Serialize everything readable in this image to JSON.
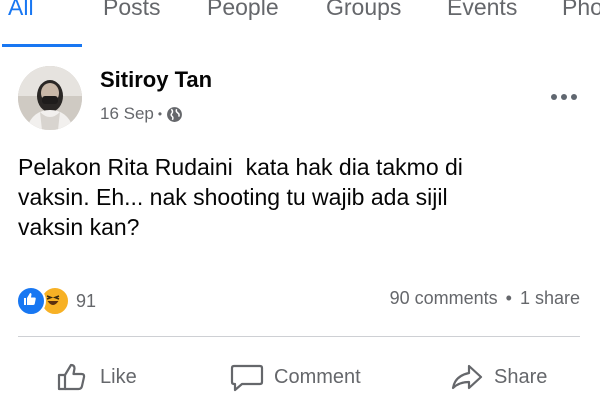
{
  "tabs": [
    {
      "label": "All",
      "active": true
    },
    {
      "label": "Posts",
      "active": false
    },
    {
      "label": "People",
      "active": false
    },
    {
      "label": "Groups",
      "active": false
    },
    {
      "label": "Events",
      "active": false
    },
    {
      "label": "Pho",
      "active": false
    }
  ],
  "post": {
    "author": "Sitiroy Tan",
    "date": "16 Sep",
    "privacy_icon": "globe-icon",
    "text_lines": [
      "Pelakon Rita Rudaini  kata hak dia takmo di",
      "vaksin. Eh... nak shooting tu wajib ada sijil",
      "vaksin kan?"
    ],
    "reactions": {
      "icons": [
        "like-reaction-icon",
        "haha-reaction-icon"
      ],
      "count": "91"
    },
    "comments": "90 comments",
    "shares": "1 share",
    "separator": "•"
  },
  "actions": {
    "like": "Like",
    "comment": "Comment",
    "share": "Share"
  },
  "colors": {
    "accent": "#1877f2",
    "secondary_text": "#65676b",
    "haha_yellow": "#f7b125"
  }
}
